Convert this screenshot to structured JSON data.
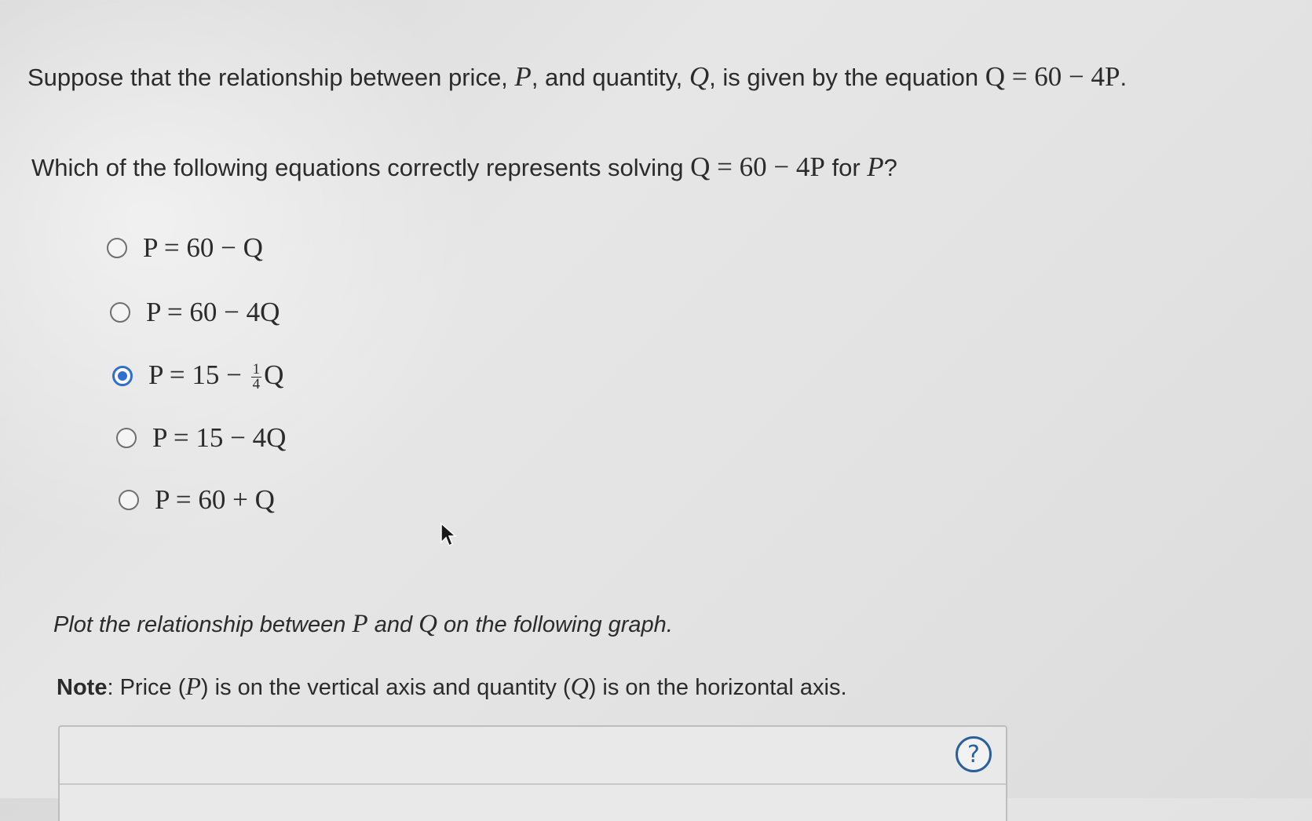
{
  "intro": {
    "prefix": "Suppose that the relationship between price, ",
    "var_p": "P",
    "mid1": ", and quantity, ",
    "var_q": "Q",
    "mid2": ", is given by the equation ",
    "equation": "Q = 60 − 4P",
    "suffix": "."
  },
  "question": {
    "prefix": "Which of the following equations correctly represents solving ",
    "equation": "Q = 60 − 4P",
    "mid": " for ",
    "var_p": "P",
    "suffix": "?"
  },
  "options": [
    {
      "label": "P = 60 − Q",
      "selected": false
    },
    {
      "label": "P = 60 − 4Q",
      "selected": false
    },
    {
      "label_prefix": "P = 15 − ",
      "frac_num": "1",
      "frac_den": "4",
      "label_suffix": "Q",
      "selected": true
    },
    {
      "label": "P = 15 − 4Q",
      "selected": false
    },
    {
      "label": "P = 60 + Q",
      "selected": false
    }
  ],
  "plot_instruction": {
    "prefix": "Plot the relationship between ",
    "var_p": "P",
    "mid": " and ",
    "var_q": "Q",
    "suffix": " on the following graph."
  },
  "note": {
    "label": "Note",
    "colon": ": Price (",
    "var_p": "P",
    "mid": ") is on the vertical axis and quantity (",
    "var_q": "Q",
    "suffix": ") is on the horizontal axis."
  },
  "help_button": {
    "label": "?",
    "icon": "question-circle-icon"
  },
  "colors": {
    "accent": "#2f6fd0",
    "help": "#2a5f9e"
  }
}
